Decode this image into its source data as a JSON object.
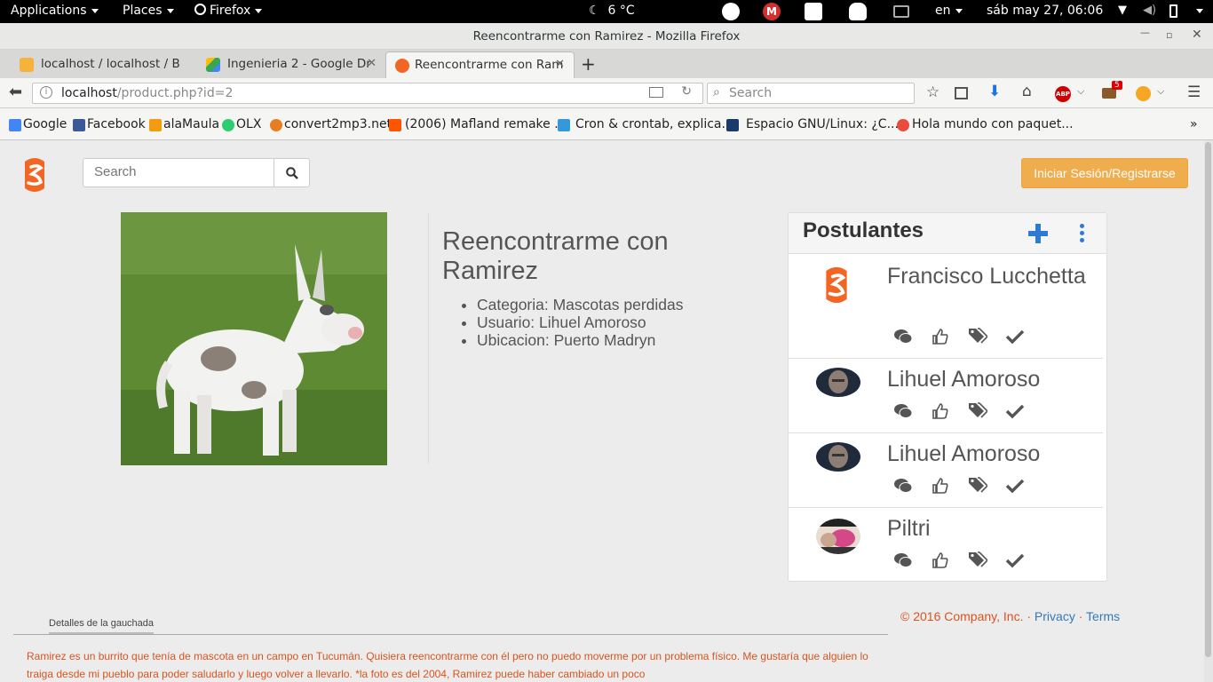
{
  "topbar": {
    "applications": "Applications",
    "places": "Places",
    "firefox": "Firefox",
    "weather": "6 °C",
    "lang": "en",
    "clock": "sáb may 27, 06:06"
  },
  "window": {
    "title": "Reencontrarme con Ramirez - Mozilla Firefox"
  },
  "tabs": [
    {
      "label": "localhost / localhost / B",
      "icon": "phpmyadmin-icon"
    },
    {
      "label": "Ingenieria 2 - Google Dr",
      "icon": "google-drive-icon"
    },
    {
      "label": "Reencontrarme con Ram",
      "icon": "gauchada-icon"
    }
  ],
  "nav": {
    "url_host": "localhost",
    "url_path": "/product.php?id=2",
    "search_placeholder": "Search",
    "abp_badge": "5"
  },
  "bookmarks": [
    {
      "label": "Google",
      "color": "#4285f4"
    },
    {
      "label": "Facebook",
      "color": "#3b5998"
    },
    {
      "label": "alaMaula",
      "color": "#f39c12"
    },
    {
      "label": "OLX",
      "color": "#2ecc71"
    },
    {
      "label": "convert2mp3.net",
      "color": "#e67e22"
    },
    {
      "label": "(2006) Mafland remake ...",
      "color": "#ff5500"
    },
    {
      "label": "Cron & crontab, explica...",
      "color": "#3498db"
    },
    {
      "label": "Espacio GNU/Linux: ¿C...",
      "color": "#1a3a6b"
    },
    {
      "label": "Hola mundo con paquet...",
      "color": "#e74c3c"
    }
  ],
  "page": {
    "search_placeholder": "Search",
    "login_button": "Iniciar Sesión/Registrarse",
    "title": "Reencontrarme con Ramirez",
    "details": [
      "Categoria: Mascotas perdidas",
      "Usuario: Lihuel Amoroso",
      "Ubicacion: Puerto Madryn"
    ],
    "panel_title": "Postulantes",
    "applicants": [
      {
        "name": "Francisco Lucchetta",
        "avatar": "gauchada-logo"
      },
      {
        "name": "Lihuel Amoroso",
        "avatar": "photo-man"
      },
      {
        "name": "Lihuel Amoroso",
        "avatar": "photo-man"
      },
      {
        "name": "Piltri",
        "avatar": "meme-image"
      }
    ],
    "footer_copy": "© 2016 Company, Inc.",
    "footer_sep": " · ",
    "footer_privacy": "Privacy",
    "footer_terms": "Terms",
    "details_tab": "Detalles de la gauchada",
    "description": "Ramirez es un burrito que tenía de mascota en un campo en Tucumán. Quisiera reencontrarme con él pero no puedo moverme por un problema físico. Me gustaría que alguien lo traiga desde mi pueblo para poder saludarlo y luego volver a llevarlo. *la foto es del 2004, Ramirez puede haber cambiado un poco"
  },
  "colors": {
    "accent_orange": "#f0ad4e",
    "brand_orange": "#f26522",
    "link_blue": "#337ab7",
    "text_red": "#d9541e",
    "plus_blue": "#2e7bcf"
  }
}
